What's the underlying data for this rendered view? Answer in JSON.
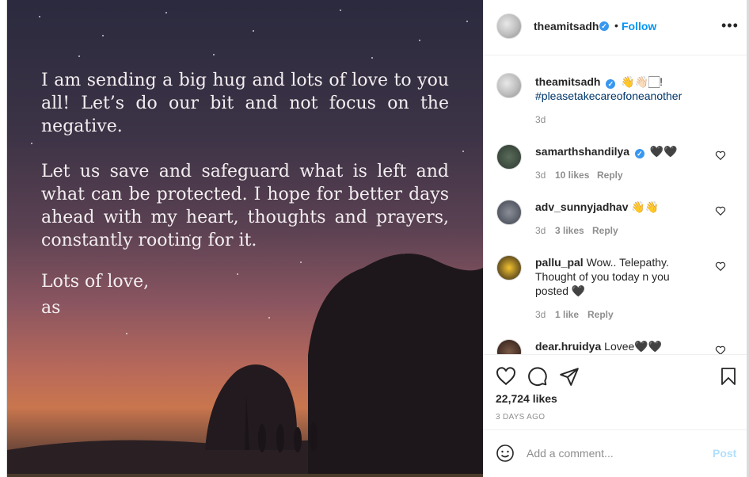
{
  "post": {
    "paragraph1": "I am sending a big hug and lots of love to you all! Let’s do our bit and not focus on the negative.",
    "paragraph2": "Let us save and safeguard what is left and what can be protected. I hope for better days ahead with my heart, thoughts and prayers, constantly rooting for it.",
    "signoff": "Lots of love,",
    "signature": "as"
  },
  "header": {
    "username": "theamitsadh",
    "separator": "•",
    "follow_label": "Follow",
    "more_icon": "more-options-icon"
  },
  "caption": {
    "username": "theamitsadh",
    "emoji_text": "👋👋🏻🏻!",
    "hashtag": "#pleasetakecareofoneanother",
    "age": "3d"
  },
  "comments": [
    {
      "username": "samarthshandilya",
      "verified": true,
      "text": "🖤🖤",
      "age": "3d",
      "likes": "10 likes",
      "reply": "Reply"
    },
    {
      "username": "adv_sunnyjadhav",
      "verified": false,
      "text": "👋👋",
      "age": "3d",
      "likes": "3 likes",
      "reply": "Reply"
    },
    {
      "username": "pallu_pal",
      "verified": false,
      "text": "Wow.. Telepathy. Thought of you today n you posted 🖤",
      "age": "3d",
      "likes": "1 like",
      "reply": "Reply"
    },
    {
      "username": "dear.hruidya",
      "verified": false,
      "text": "Lovee🖤🖤"
    }
  ],
  "actions": {
    "like_icon": "heart-icon",
    "comment_icon": "comment-icon",
    "share_icon": "share-icon",
    "save_icon": "bookmark-icon",
    "likes": "22,724 likes",
    "date": "3 DAYS AGO"
  },
  "add_comment": {
    "emoji_icon": "emoji-icon",
    "placeholder": "Add a comment...",
    "post_label": "Post"
  },
  "colors": {
    "link_blue": "#0095f6",
    "verified_blue": "#3897f0",
    "hashtag_blue": "#00376b",
    "muted": "#8e8e8e",
    "post_disabled": "#b2dffc"
  }
}
